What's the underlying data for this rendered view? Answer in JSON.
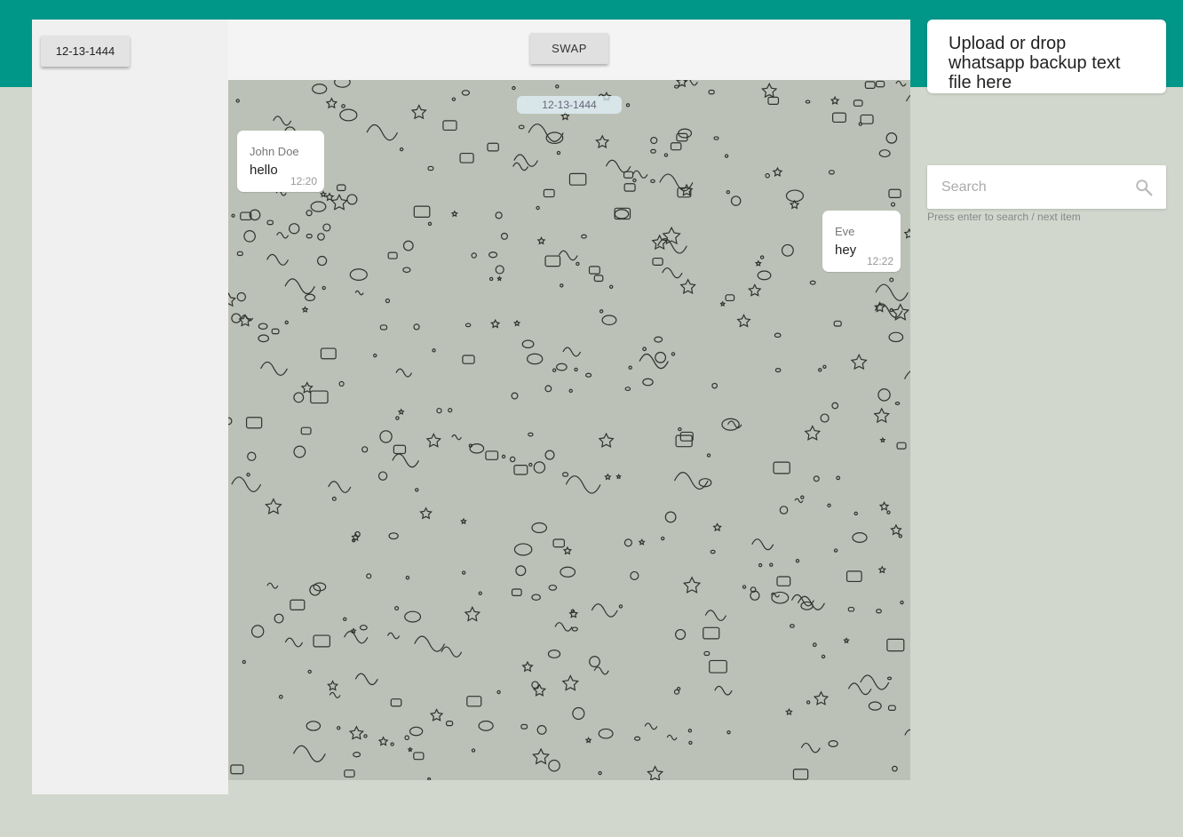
{
  "sidebar": {
    "dates": [
      "12-13-1444"
    ]
  },
  "header": {
    "swap_label": "SWAP"
  },
  "chat": {
    "date_divider": "12-13-1444",
    "messages": [
      {
        "sender": "John Doe",
        "text": "hello",
        "time": "12:20",
        "side": "left"
      },
      {
        "sender": "Eve",
        "text": "hey",
        "time": "12:22",
        "side": "right"
      }
    ]
  },
  "upload": {
    "label": "Upload or drop whatsapp backup text file here"
  },
  "search": {
    "placeholder": "Search",
    "value": "",
    "hint": "Press enter to search / next item"
  },
  "colors": {
    "accent": "#009688",
    "page_background": "#d1d7cd",
    "chat_background": "#bcc1b7"
  },
  "icons": {
    "search": "search-icon",
    "wallpaper": "doodle-pattern"
  }
}
